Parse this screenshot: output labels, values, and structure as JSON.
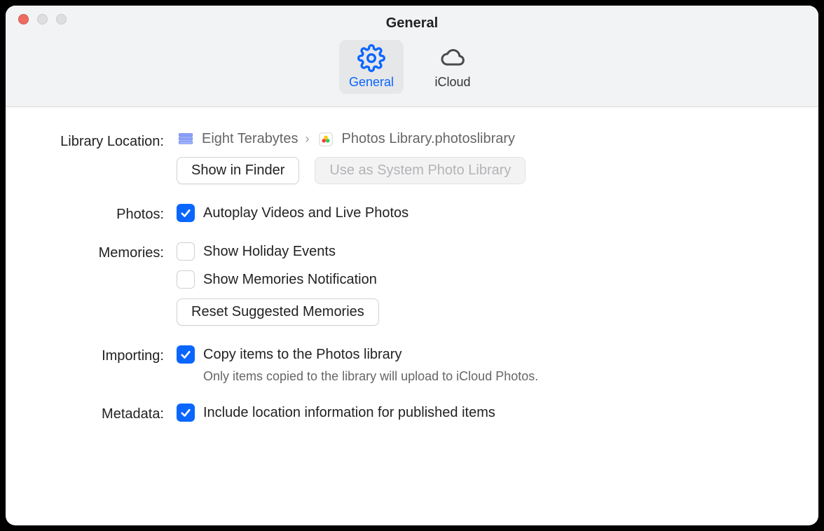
{
  "window": {
    "title": "General"
  },
  "tabs": [
    {
      "label": "General",
      "active": true,
      "icon": "gear-icon"
    },
    {
      "label": "iCloud",
      "active": false,
      "icon": "cloud-icon"
    }
  ],
  "sections": {
    "library_location": {
      "label": "Library Location:",
      "crumbs": [
        {
          "icon": "drive-icon",
          "text": "Eight Terabytes"
        },
        {
          "icon": "photos-library-icon",
          "text": "Photos Library.photoslibrary"
        }
      ],
      "buttons": {
        "show_in_finder": "Show in Finder",
        "use_as_system": "Use as System Photo Library"
      }
    },
    "photos": {
      "label": "Photos:",
      "autoplay": {
        "checked": true,
        "label": "Autoplay Videos and Live Photos"
      }
    },
    "memories": {
      "label": "Memories:",
      "holiday": {
        "checked": false,
        "label": "Show Holiday Events"
      },
      "notification": {
        "checked": false,
        "label": "Show Memories Notification"
      },
      "reset_button": "Reset Suggested Memories"
    },
    "importing": {
      "label": "Importing:",
      "copy": {
        "checked": true,
        "label": "Copy items to the Photos library"
      },
      "help": "Only items copied to the library will upload to iCloud Photos."
    },
    "metadata": {
      "label": "Metadata:",
      "location": {
        "checked": true,
        "label": "Include location information for published items"
      }
    }
  }
}
